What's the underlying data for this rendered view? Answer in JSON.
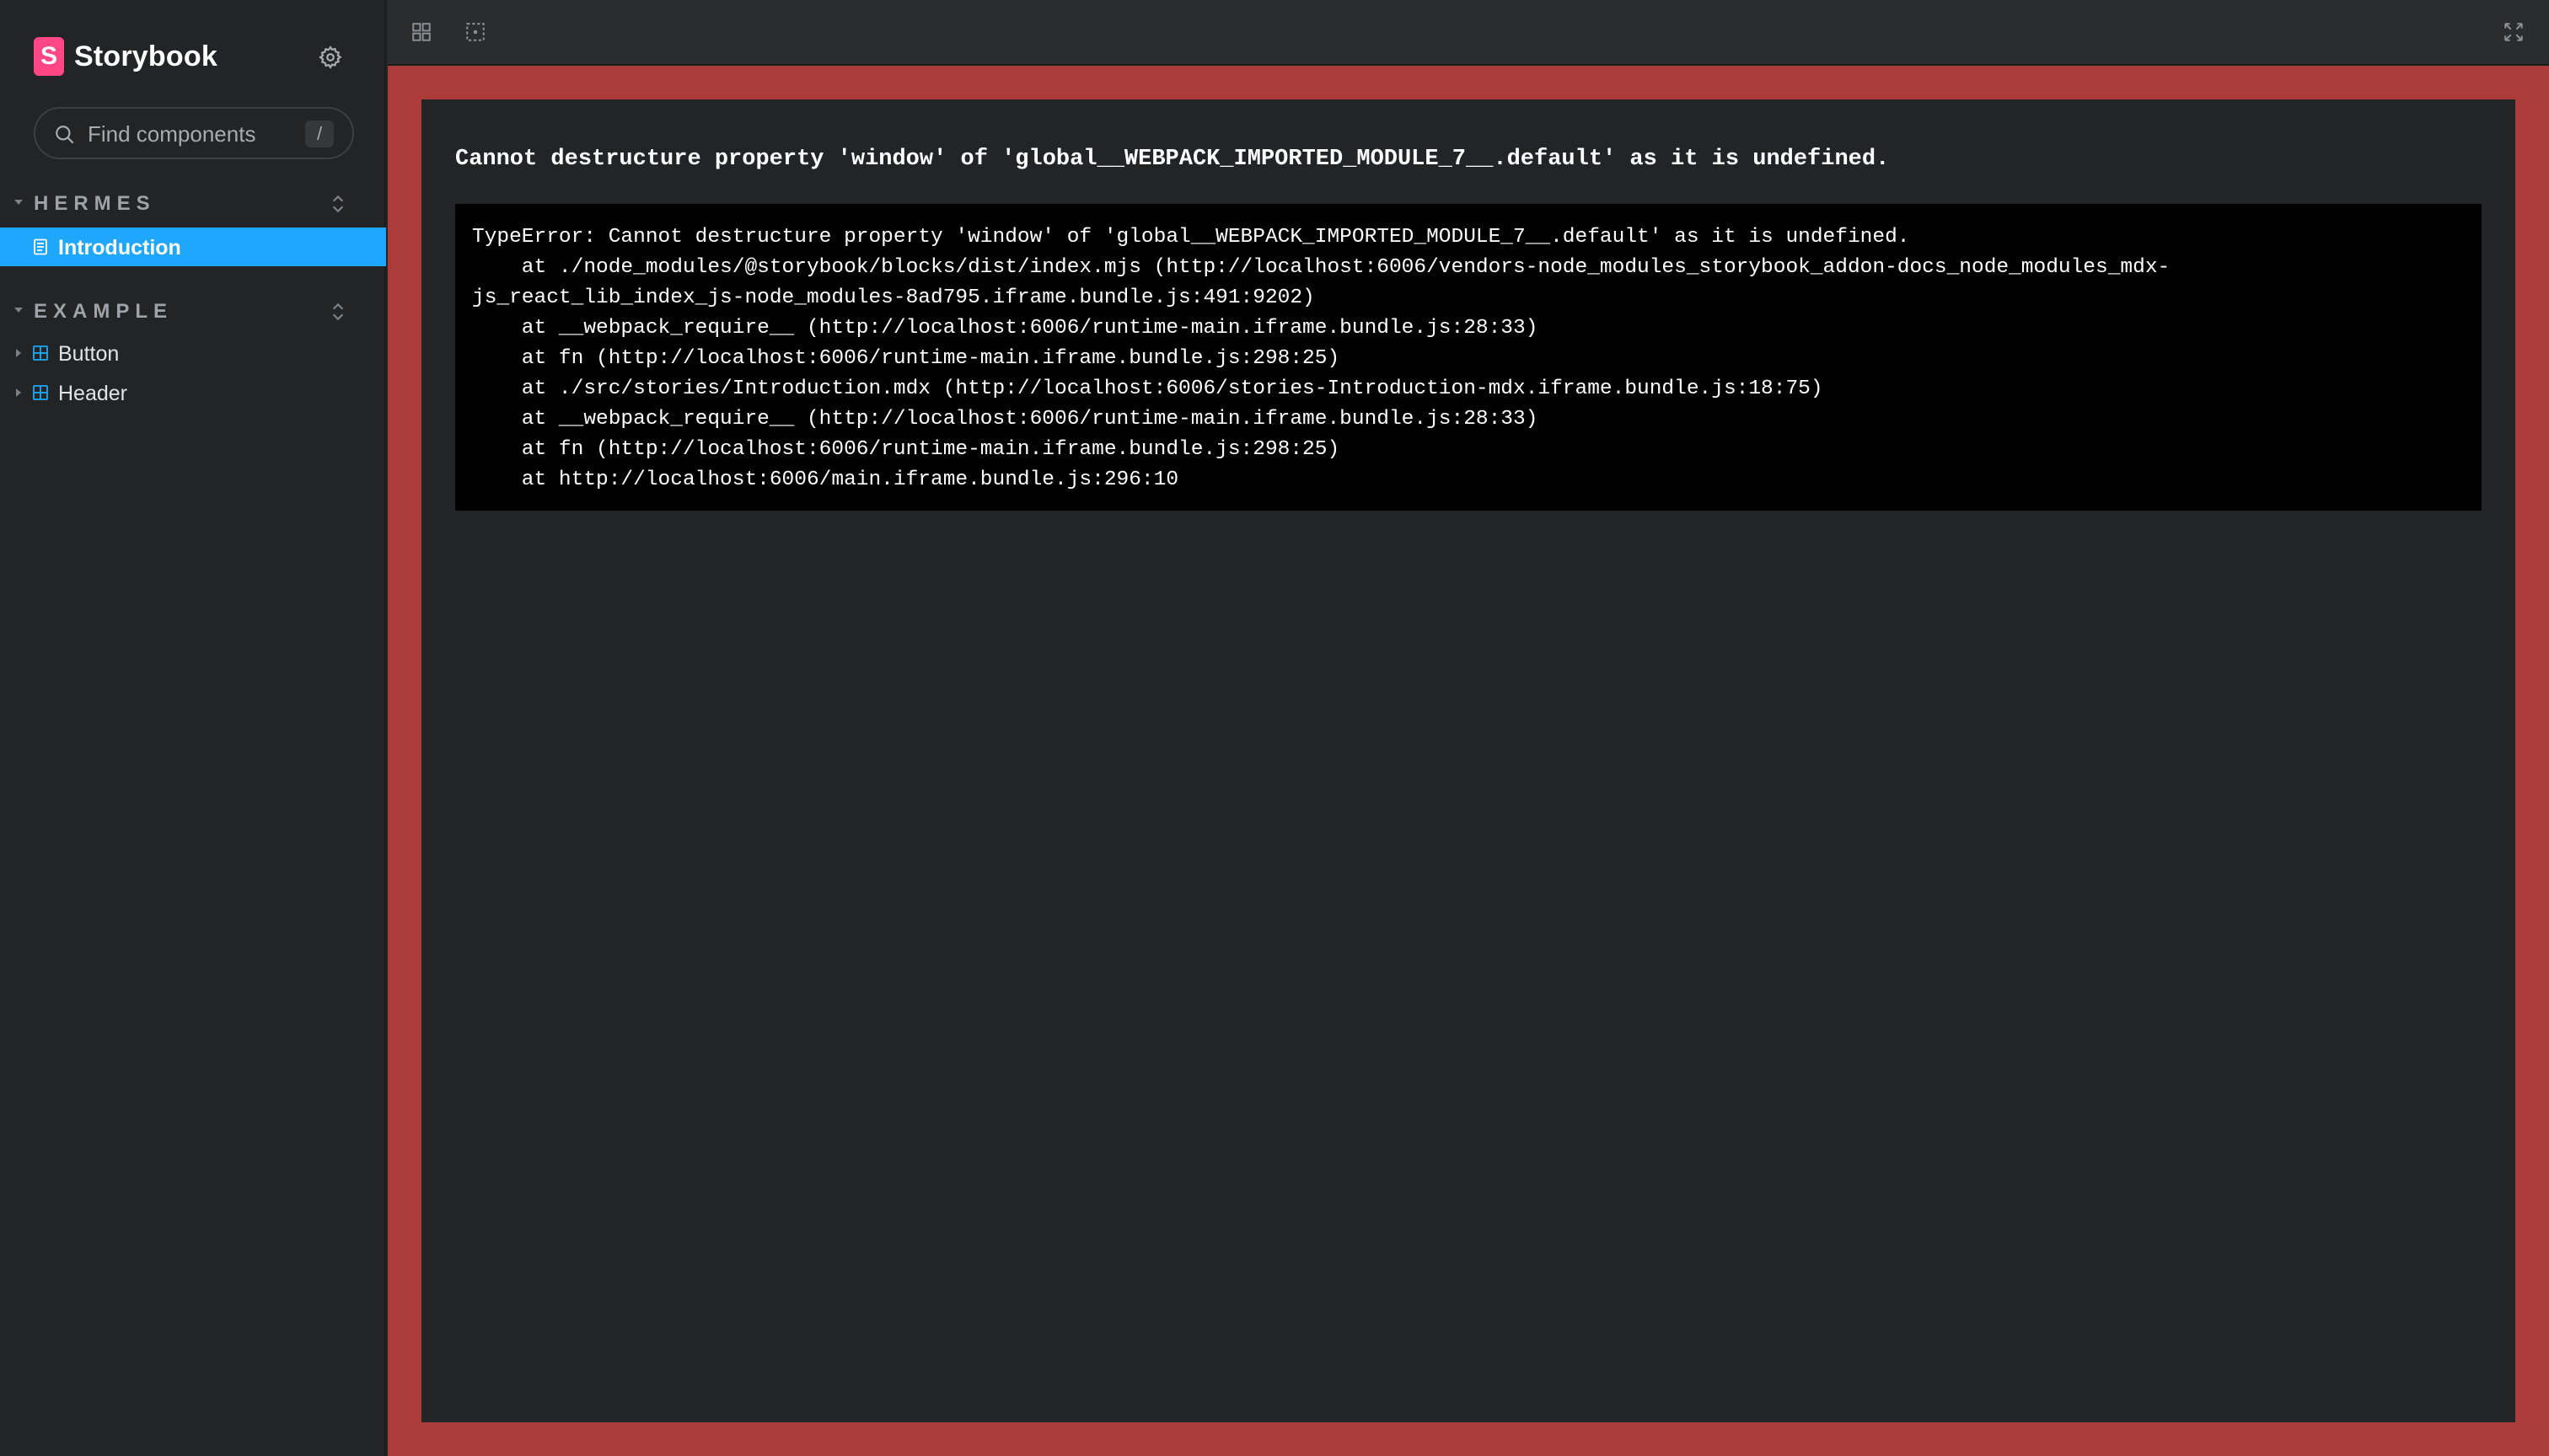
{
  "sidebar": {
    "brand": {
      "logo_letter": "S",
      "name": "Storybook"
    },
    "settings_icon": "gear-icon",
    "search": {
      "placeholder": "Find components",
      "shortcut": "/"
    },
    "groups": [
      {
        "label": "HERMES",
        "items": [
          {
            "label": "Introduction",
            "icon": "document-icon",
            "selected": true
          }
        ]
      },
      {
        "label": "EXAMPLE",
        "items": [
          {
            "label": "Button",
            "icon": "component-icon",
            "selected": false
          },
          {
            "label": "Header",
            "icon": "component-icon",
            "selected": false
          }
        ]
      }
    ]
  },
  "toolbar": {
    "buttons": [
      "grid-icon",
      "outline-icon"
    ],
    "fullscreen_icon": "fullscreen-icon"
  },
  "error": {
    "title": "Cannot destructure property 'window' of 'global__WEBPACK_IMPORTED_MODULE_7__.default' as it is undefined.",
    "stack": [
      "TypeError: Cannot destructure property 'window' of 'global__WEBPACK_IMPORTED_MODULE_7__.default' as it is undefined.",
      "    at ./node_modules/@storybook/blocks/dist/index.mjs (http://localhost:6006/vendors-node_modules_storybook_addon-docs_node_modules_mdx-",
      "js_react_lib_index_js-node_modules-8ad795.iframe.bundle.js:491:9202)",
      "    at __webpack_require__ (http://localhost:6006/runtime-main.iframe.bundle.js:28:33)",
      "    at fn (http://localhost:6006/runtime-main.iframe.bundle.js:298:25)",
      "    at ./src/stories/Introduction.mdx (http://localhost:6006/stories-Introduction-mdx.iframe.bundle.js:18:75)",
      "    at __webpack_require__ (http://localhost:6006/runtime-main.iframe.bundle.js:28:33)",
      "    at fn (http://localhost:6006/runtime-main.iframe.bundle.js:298:25)",
      "    at http://localhost:6006/main.iframe.bundle.js:296:10"
    ]
  },
  "colors": {
    "sidebar_bg": "#222425",
    "selected_bg": "#1ea7fd",
    "error_border": "#ab3c3a",
    "brand_pink": "#ff4785"
  }
}
